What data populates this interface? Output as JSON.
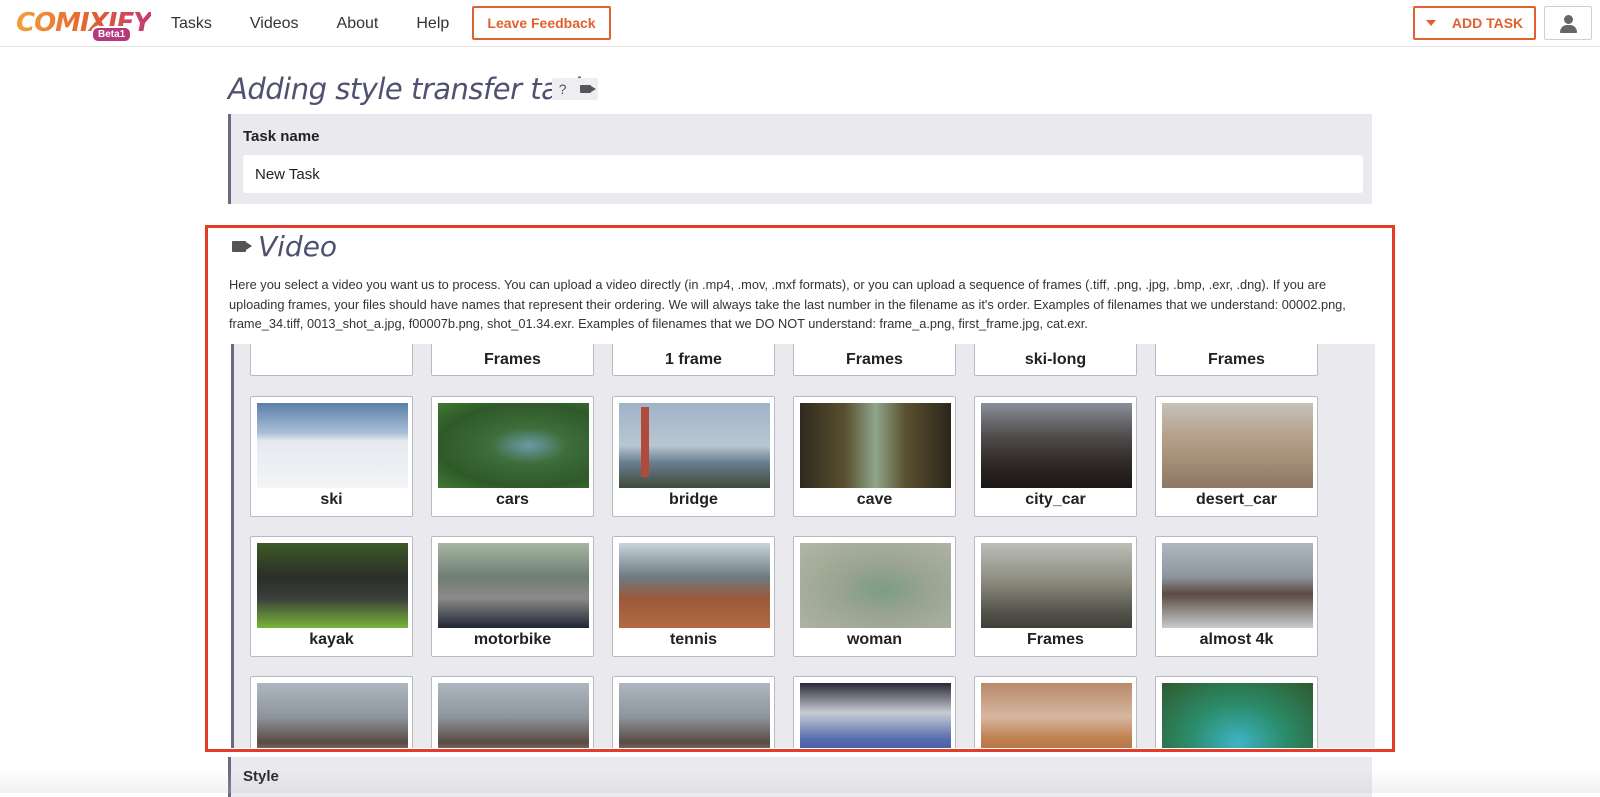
{
  "header": {
    "logo_text": "COMIXIFY",
    "logo_badge": "Beta1",
    "nav": [
      "Tasks",
      "Videos",
      "About",
      "Help"
    ],
    "feedback_label": "Leave Feedback",
    "add_task_label": "ADD TASK",
    "accent_color": "#e0602e"
  },
  "page": {
    "title": "Adding style transfer task",
    "help_badge": "?"
  },
  "task_name": {
    "label": "Task name",
    "value": "New Task"
  },
  "video": {
    "title": "Video",
    "description": "Here you select a video you want us to process. You can upload a video directly (in .mp4, .mov, .mxf formats), or you can upload a sequence of frames (.tiff, .png, .jpg, .bmp, .exr, .dng). If you are uploading frames, your files should have names that represent their ordering. We will always take the last number in the filename as it's order. Examples of filenames that we understand: 00002.png, frame_34.tiff, 0013_shot_a.jpg, f00007b.png, shot_01.34.exr. Examples of filenames that we DO NOT understand: frame_a.png, first_frame.jpg, cat.exr.",
    "partial_row": [
      "",
      "Frames",
      "1 frame",
      "Frames",
      "ski-long",
      "Frames"
    ],
    "rows": [
      [
        "ski",
        "cars",
        "bridge",
        "cave",
        "city_car",
        "desert_car"
      ],
      [
        "kayak",
        "motorbike",
        "tennis",
        "woman",
        "Frames",
        "almost 4k"
      ],
      [
        "",
        "",
        "",
        "",
        "",
        ""
      ]
    ]
  },
  "style": {
    "label": "Style"
  }
}
